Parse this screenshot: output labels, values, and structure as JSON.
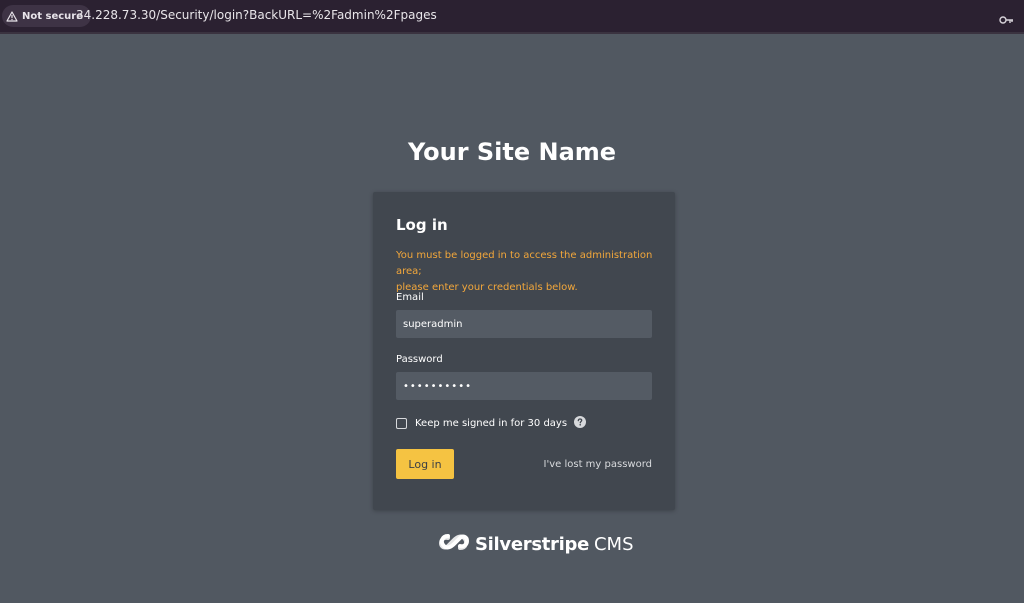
{
  "browser": {
    "security_chip": "Not secure",
    "url": "34.228.73.30/Security/login?BackURL=%2Fadmin%2Fpages",
    "warning_icon": "warning-icon",
    "key_icon": "key-icon"
  },
  "page": {
    "site_title": "Your Site Name",
    "background_color": "#515861"
  },
  "login": {
    "title": "Log in",
    "message_line1": "You must be logged in to access the administration area;",
    "message_line2": "please enter your credentials below.",
    "email_label": "Email",
    "email_value": "superadmin",
    "password_label": "Password",
    "password_value": "superadmin",
    "remember_label": "Keep me signed in for 30 days",
    "remember_checked": false,
    "help_icon": "question-icon",
    "submit_label": "Log in",
    "lost_password_label": "I've lost my password",
    "accent_color": "#f5c342",
    "message_color": "#f2a73b"
  },
  "footer": {
    "brand_name": "Silverstripe",
    "brand_suffix": "CMS"
  }
}
